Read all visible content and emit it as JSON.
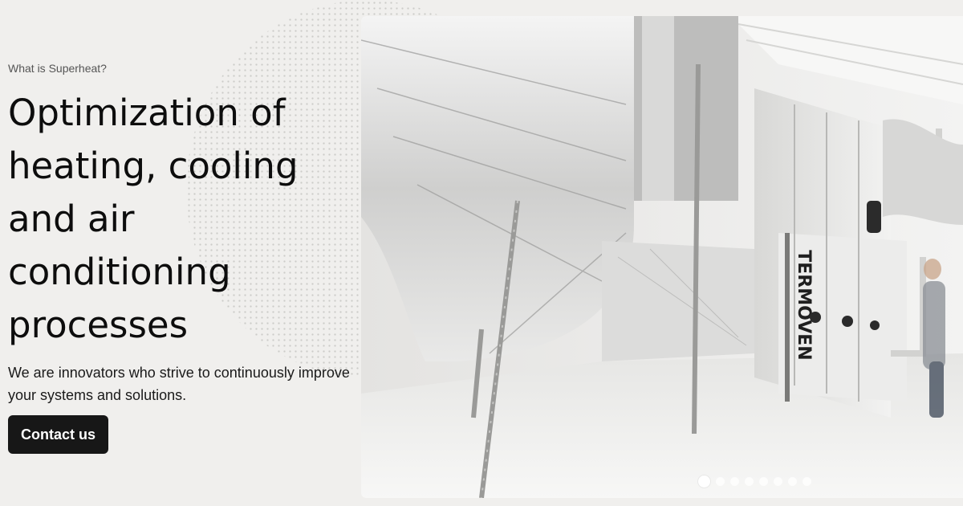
{
  "hero": {
    "eyebrow": "What is Superheat?",
    "headline": "Optimization of heating, cooling and air conditioning processes",
    "subtext": "We are innovators who strive to continuously improve your systems and solutions.",
    "cta_label": "Contact us"
  },
  "media": {
    "unit_brand_text": "TERMOVEN",
    "slider": {
      "slide_count": 8,
      "active_slide": 1
    }
  },
  "colors": {
    "page_background": "#f0efed",
    "button_background": "#171717",
    "button_text": "#ffffff",
    "text": "#0d0d0d"
  },
  "icons": [
    "dotted-circle-pattern",
    "slider-dot"
  ]
}
